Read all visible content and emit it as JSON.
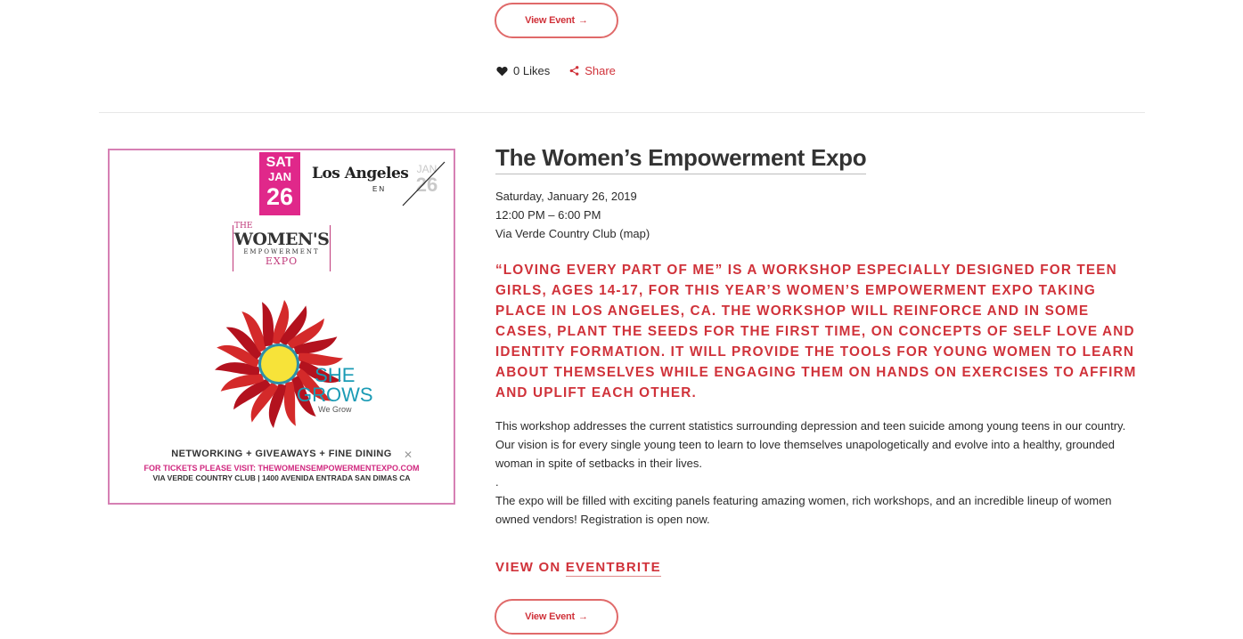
{
  "prev_event": {
    "view_button_label": "View Event",
    "likes_label": "0 Likes",
    "share_label": "Share"
  },
  "event": {
    "title": "The Women’s Empowerment Expo",
    "date": "Saturday, January 26, 2019",
    "time": "12:00 PM – 6:00 PM",
    "location": "Via Verde Country Club",
    "map_label": "(map)",
    "headline": "“Loving Every Part of Me” is a workshop especially designed for teen girls, ages 14-17, for this year’s Women’s Empowerment Expo taking place in Los Angeles, CA. The workshop will reinforce and in some cases, plant the seeds for the first time, on concepts of self love and identity formation. It will provide the tools for young women to learn about themselves while engaging them on hands on exercises to affirm and uplift each other.",
    "paragraph1": "This workshop addresses the current statistics surrounding depression and teen suicide among young teens in our country. Our vision is for every single young teen to learn to love themselves unapologetically and evolve into a healthy, grounded woman in spite of setbacks in their lives.",
    "paragraph_dot": ".",
    "paragraph2": "The expo will be filled with exciting panels featuring amazing women, rich workshops, and an incredible lineup of women owned vendors! Registration is open now.",
    "view_on_prefix": "View on ",
    "view_on_link": "Eventbrite",
    "view_button_label": "View Event"
  },
  "flyer": {
    "day": "SAT",
    "month": "JAN",
    "date_num": "26",
    "la_title": "Los Angeles",
    "la_sub": "EN",
    "faded_month": "JAN",
    "faded_num": "26",
    "logo_the": "THE",
    "logo_womens": "WOMEN'S",
    "logo_empowerment": "EMPOWERMENT",
    "logo_expo": "EXPO",
    "she_grows_1": "SHE",
    "she_grows_2": "GROWS",
    "we_grow": "We Grow",
    "networking": "NETWORKING + GIVEAWAYS + FINE DINING",
    "tickets": "FOR TICKETS PLEASE VISIT: THEWOMENSEMPOWERMENTEXPO.COM",
    "venue": "VIA VERDE COUNTRY CLUB | 1400 AVENIDA ENTRADA SAN DIMAS CA",
    "x_mark": "✕"
  },
  "icons": {
    "arrow": "→",
    "heart": "heart-icon",
    "share": "share-icon"
  },
  "colors": {
    "accent": "#d0323a",
    "button_border": "#e06a6a",
    "flyer_border": "#d680b4",
    "flyer_pink": "#e0288a"
  }
}
